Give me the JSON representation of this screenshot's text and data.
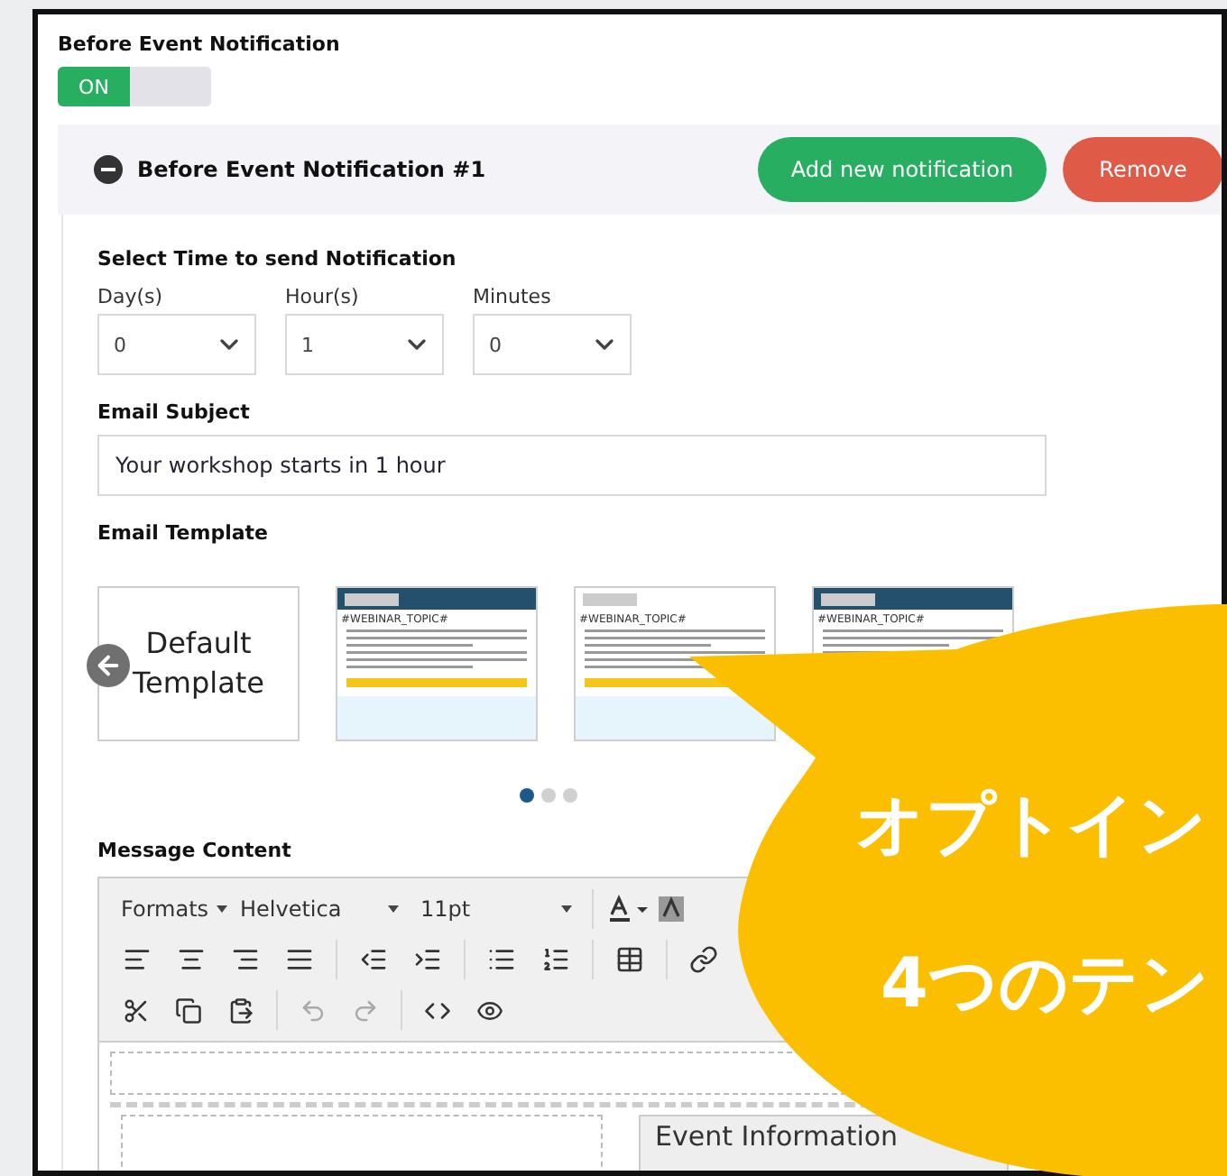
{
  "section": {
    "title": "Before Event Notification",
    "toggle": {
      "label": "ON",
      "on": true
    }
  },
  "notification": {
    "title": "Before Event Notification #1",
    "expanded": true,
    "buttons": [
      {
        "label": "Add new notification",
        "kind": "add"
      },
      {
        "label": "Remove",
        "kind": "remove"
      }
    ]
  },
  "time": {
    "title": "Select Time to send Notification",
    "selects": [
      {
        "label": "Day(s)",
        "value": "0"
      },
      {
        "label": "Hour(s)",
        "value": "1"
      },
      {
        "label": "Minutes",
        "value": "0"
      }
    ]
  },
  "subject": {
    "label": "Email Subject",
    "value": "Your workshop starts in 1 hour"
  },
  "templates": {
    "label": "Email Template",
    "items": [
      {
        "kind": "default",
        "title": "Default Template"
      },
      {
        "kind": "banner",
        "heading": "#WEBINAR_TOPIC#"
      },
      {
        "kind": "plain",
        "heading": "#WEBINAR_TOPIC#"
      },
      {
        "kind": "sidebar",
        "heading": "#WEBINAR_TOPIC#"
      }
    ],
    "pages": [
      {
        "selected": true
      },
      {
        "selected": false
      },
      {
        "selected": false
      }
    ]
  },
  "message": {
    "label": "Message Content",
    "toolbar": {
      "format": "Formats",
      "font": "Helvetica",
      "size": "11pt"
    },
    "preview": {
      "sidebar_title": "Event Information"
    }
  },
  "callout": {
    "lines": [
      "オプトイン",
      "4つのテン"
    ]
  }
}
